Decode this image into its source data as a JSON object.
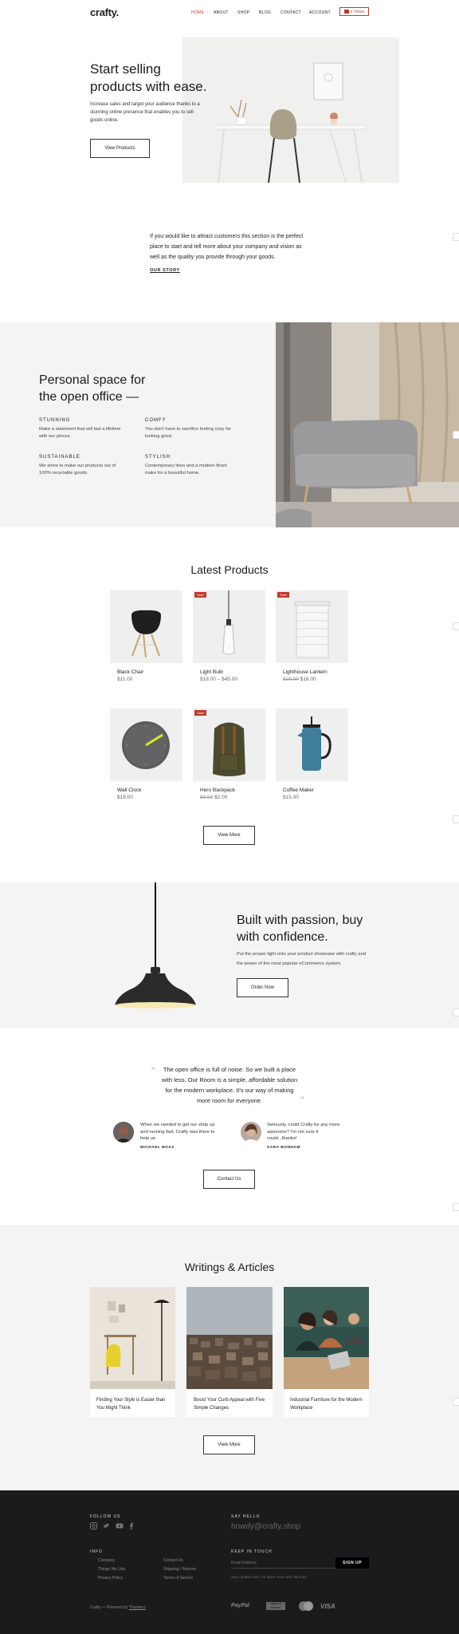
{
  "header": {
    "logo": "crafty.",
    "nav": [
      "HOME",
      "ABOUT",
      "SHOP",
      "BLOG",
      "CONTACT",
      "ACCOUNT"
    ],
    "cart_label": "0 ITEMS"
  },
  "hero": {
    "title_line1": "Start selling",
    "title_line2": "products with ease.",
    "desc": "Increase sales and target your audience thanks to a stunning online presence that enables you to sell goods online.",
    "button": "View Products"
  },
  "story": {
    "text": "If you would like to attract customers this section is the perfect place to start and tell more about your company and vision as well as the quality you provide through your goods.",
    "link": "OUR STORY"
  },
  "features": {
    "title_line1": "Personal space for",
    "title_line2": "the open office —",
    "items": [
      {
        "label": "STUNNING",
        "text": "Make a statement that will last a lifetime with our pieces."
      },
      {
        "label": "COMFY",
        "text": "You don't have to sacrifice feeling cozy for looking good."
      },
      {
        "label": "SUSTAINABLE",
        "text": "We strive to make our products out of 100% recyclable goods."
      },
      {
        "label": "STYLISH",
        "text": "Contemporary lines and a modern finish make for a beautiful home."
      }
    ]
  },
  "products": {
    "title": "Latest Products",
    "sale_label": "Sale!",
    "items": [
      {
        "name": "Black Chair",
        "price": "$11.00",
        "old_price": "",
        "sale": false
      },
      {
        "name": "Light Bulb",
        "price": "$18.00 – $45.00",
        "old_price": "",
        "sale": true
      },
      {
        "name": "Lighthouse Lantern",
        "price": "$18.00",
        "old_price": "$28.99",
        "sale": true
      },
      {
        "name": "Wall Clock",
        "price": "$18.00",
        "old_price": "",
        "sale": false
      },
      {
        "name": "Hero Backpack",
        "price": "$2.00",
        "old_price": "$9.99",
        "sale": true
      },
      {
        "name": "Coffee Maker",
        "price": "$15.00",
        "old_price": "",
        "sale": false
      }
    ],
    "button": "View More"
  },
  "passion": {
    "title_line1": "Built with passion, buy",
    "title_line2": "with confidence.",
    "desc": "Put the proper light onto your product showcase with crafty and the power of the most popular eCommerce system.",
    "button": "Order Now"
  },
  "quote": {
    "text": "The open office is full of noise. So we built a place with less. Our Room is a simple, affordable solution for the modern workplace. It's our way of making more room for everyone.",
    "testimonials": [
      {
        "text": "When we needed to get our shop up and running fast, Crafty was there to help us.",
        "name": "MICHAEL BOAZ"
      },
      {
        "text": "Seriously, could Crafty be any more awesome? I'm not sure it could...thanks!",
        "name": "SARA BONHAM"
      }
    ],
    "button": "Contact Us"
  },
  "articles": {
    "title": "Writings & Articles",
    "items": [
      {
        "title": "Finding Your Style is Easier than You Might Think"
      },
      {
        "title": "Boost Your Curb Appeal with Five Simple Changes"
      },
      {
        "title": "Industrial Furniture for the Modern Workplace"
      }
    ],
    "button": "View More"
  },
  "footer": {
    "follow_label": "FOLLOW US",
    "social_icons": [
      "instagram-icon",
      "twitter-icon",
      "youtube-icon",
      "facebook-icon"
    ],
    "hello_label": "SAY HELLO",
    "email": "howdy@crafty.shop",
    "info_label": "INFO",
    "links_col1": [
      "Company",
      "Things We Like",
      "Privacy Policy"
    ],
    "links_col2": [
      "Contact Us",
      "Shipping / Returns",
      "Terms of Service"
    ],
    "keep_label": "KEEP IN TOUCH",
    "email_placeholder": "Email Address",
    "signup_button": "SIGN UP",
    "newsletter_note": "Stay updated with our latest news and offerings",
    "copyright": "Crafty — Powered by",
    "powered_link": "Themeco",
    "payments": [
      "PayPal",
      "AMERICAN EXPRESS",
      "mastercard",
      "VISA"
    ]
  },
  "colors": {
    "accent": "#c0392b",
    "footer_bg": "#1b1b1d",
    "section_gray": "#f4f4f4"
  }
}
